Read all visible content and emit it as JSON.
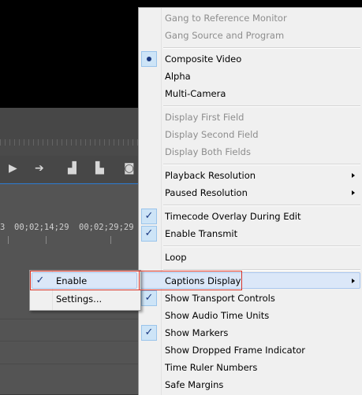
{
  "background": {
    "timecodes": [
      "3",
      "00;02;14;29",
      "00;02;29;29"
    ]
  },
  "menu": {
    "items": [
      {
        "label": "Gang to Reference Monitor",
        "disabled": true
      },
      {
        "label": "Gang Source and Program",
        "disabled": true
      },
      {
        "label": "Composite Video",
        "mark": "radio"
      },
      {
        "label": "Alpha"
      },
      {
        "label": "Multi-Camera"
      },
      {
        "label": "Display First Field",
        "disabled": true
      },
      {
        "label": "Display Second Field",
        "disabled": true
      },
      {
        "label": "Display Both Fields",
        "disabled": true
      },
      {
        "label": "Playback Resolution",
        "submenu": true
      },
      {
        "label": "Paused Resolution",
        "submenu": true
      },
      {
        "label": "Timecode Overlay During Edit",
        "mark": "check"
      },
      {
        "label": "Enable Transmit",
        "mark": "check"
      },
      {
        "label": "Loop"
      },
      {
        "label": "Captions Display",
        "submenu": true,
        "highlighted": true
      },
      {
        "label": "Show Transport Controls",
        "mark": "check"
      },
      {
        "label": "Show Audio Time Units"
      },
      {
        "label": "Show Markers",
        "mark": "check"
      },
      {
        "label": "Show Dropped Frame Indicator"
      },
      {
        "label": "Time Ruler Numbers"
      },
      {
        "label": "Safe Margins"
      }
    ]
  },
  "submenu": {
    "items": [
      {
        "label": "Enable",
        "checked": true,
        "highlighted": true
      },
      {
        "label": "Settings..."
      }
    ]
  },
  "colors": {
    "menu_bg": "#f0f0f0",
    "highlight": "#dbe7f8",
    "check_blue": "#1c3a82",
    "annotation_red": "#d9352a",
    "timeline_accent": "#2c7bd1"
  }
}
